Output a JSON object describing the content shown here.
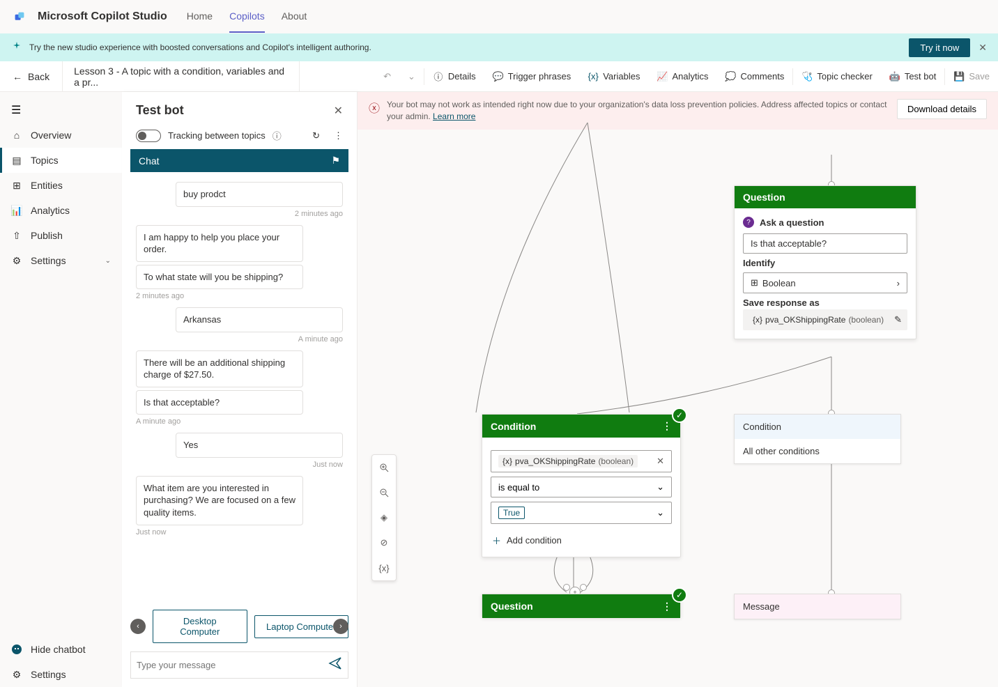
{
  "app": {
    "title": "Microsoft Copilot Studio"
  },
  "topnav": {
    "home": "Home",
    "copilots": "Copilots",
    "about": "About"
  },
  "banner": {
    "text": "Try the new studio experience with boosted conversations and Copilot's intelligent authoring.",
    "cta": "Try it now"
  },
  "toolbar": {
    "back": "Back",
    "breadcrumb": "Lesson 3 - A topic with a condition, variables and a pr...",
    "details": "Details",
    "trigger": "Trigger phrases",
    "variables": "Variables",
    "analytics": "Analytics",
    "comments": "Comments",
    "checker": "Topic checker",
    "testbot": "Test bot",
    "save": "Save"
  },
  "leftnav": {
    "overview": "Overview",
    "topics": "Topics",
    "entities": "Entities",
    "analytics": "Analytics",
    "publish": "Publish",
    "settings": "Settings",
    "hidechat": "Hide chatbot",
    "settings2": "Settings"
  },
  "testpanel": {
    "title": "Test bot",
    "tracking": "Tracking between topics",
    "chathdr": "Chat",
    "messages": {
      "m1": "buy prodct",
      "t1": "2 minutes ago",
      "m2": "I am happy to help you place your order.",
      "m3": "To what state will you be shipping?",
      "t3": "2 minutes ago",
      "m4": "Arkansas",
      "t4": "A minute ago",
      "m5": "There will be an additional shipping charge of $27.50.",
      "m6": "Is that acceptable?",
      "t6": "A minute ago",
      "m7": "Yes",
      "t7": "Just now",
      "m8": "What item are you interested in purchasing? We are focused on a few quality items.",
      "t8": "Just now"
    },
    "sug1": "Desktop Computer",
    "sug2": "Laptop Computer",
    "placeholder": "Type your message"
  },
  "warning": {
    "text": "Your bot may not work as intended right now due to your organization's data loss prevention policies. Address affected topics or contact your admin.  ",
    "link": "Learn more",
    "download": "Download details"
  },
  "zoom": {
    "var": "{x}"
  },
  "qcard": {
    "hdr": "Question",
    "ask": "Ask a question",
    "qtext": "Is that acceptable?",
    "identify": "Identify",
    "idval": "Boolean",
    "savelbl": "Save response as",
    "varname": "pva_OKShippingRate",
    "vartype": "(boolean)",
    "varprefix": "{x}"
  },
  "cond": {
    "hdr": "Condition",
    "varprefix": "{x}",
    "varname": "pva_OKShippingRate",
    "vartype": "(boolean)",
    "op": "is equal to",
    "val": "True",
    "add": "Add condition"
  },
  "cond2": {
    "hdr": "Condition",
    "body": "All other conditions"
  },
  "q2": {
    "hdr": "Question"
  },
  "msgcard": {
    "hdr": "Message"
  }
}
